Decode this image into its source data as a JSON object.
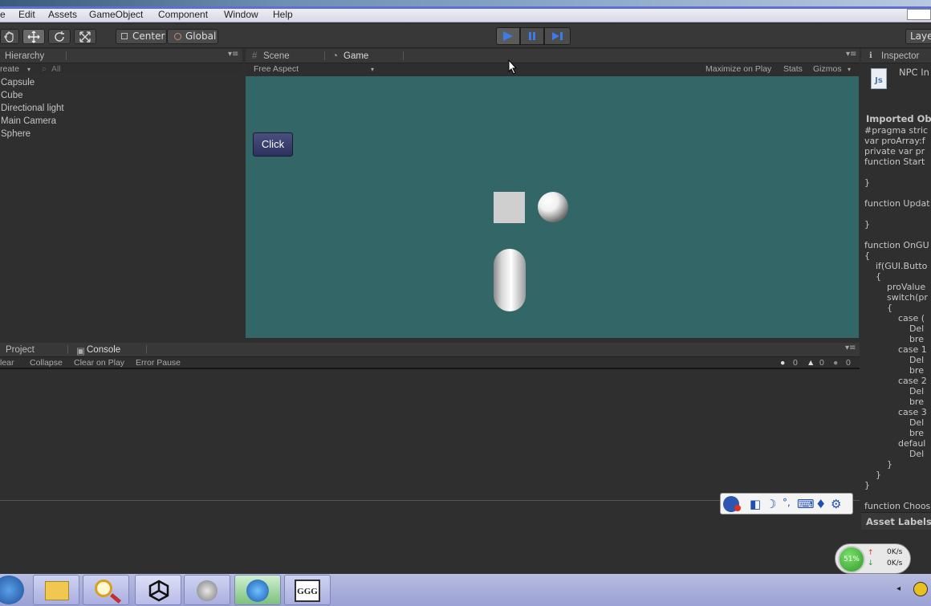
{
  "menu": {
    "items": [
      "e",
      "Edit",
      "Assets",
      "GameObject",
      "Component",
      "Window",
      "Help"
    ]
  },
  "toolbar": {
    "pivot_label": "Center",
    "space_label": "Global",
    "layers_label": "Laye",
    "tools": [
      "hand-icon",
      "move-icon",
      "rotate-icon",
      "scale-icon"
    ],
    "play_state": "playing"
  },
  "hierarchy": {
    "title": "Hierarchy",
    "create_label": "reate",
    "search_placeholder": "All",
    "items": [
      "Capsule",
      "Cube",
      "Directional light",
      "Main Camera",
      "Sphere"
    ]
  },
  "view_tabs": {
    "scene_label": "Scene",
    "game_label": "Game",
    "aspect_label": "Free Aspect",
    "maximize_label": "Maximize on Play",
    "stats_label": "Stats",
    "gizmos_label": "Gizmos"
  },
  "game": {
    "button_label": "Click",
    "background_color": "#336666"
  },
  "console": {
    "project_tab": "Project",
    "console_tab": "Console",
    "clear_label": "lear",
    "collapse_label": "Collapse",
    "clear_on_play_label": "Clear on Play",
    "error_pause_label": "Error Pause",
    "error_count": "0",
    "warning_count": "0",
    "log_count": "0"
  },
  "inspector": {
    "title": "Inspector",
    "asset_name": "NPC In",
    "imported_header": "Imported Ob",
    "asset_labels": "Asset Labels",
    "code_lines": [
      "#pragma stric",
      "var proArray:f",
      "private var pr",
      "function Start",
      "",
      "}",
      "",
      "function Updat",
      "",
      "}",
      "",
      "function OnGU",
      "{",
      "    if(GUI.Butto",
      "    {",
      "        proValue",
      "        switch(pr",
      "        {",
      "            case (",
      "                Del",
      "                bre",
      "            case 1",
      "                Del",
      "                bre",
      "            case 2",
      "                Del",
      "                bre",
      "            case 3",
      "                Del",
      "                bre",
      "            defaul",
      "                Del",
      "        }",
      "    }",
      "}",
      "",
      "function Choos"
    ]
  },
  "system": {
    "cpu_percent": "51%",
    "upload_speed": "0K/s",
    "download_speed": "0K/s",
    "taskbar_apps": [
      "start-orb-icon",
      "file-explorer-icon",
      "search-tool-icon",
      "unity-icon",
      "remote-app-icon",
      "media-app-icon",
      "ggg-app-icon"
    ],
    "ggg_label": "GGG"
  }
}
